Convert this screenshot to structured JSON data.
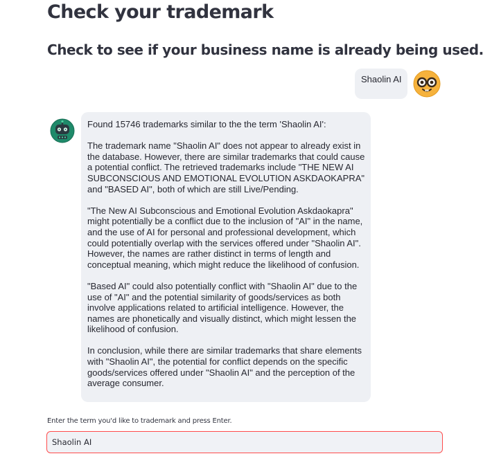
{
  "header": {
    "title": "Check your trademark",
    "subtitle": "Check to see if your business name is already being used."
  },
  "chat": {
    "user_message": {
      "text": "Shaolin AI",
      "avatar_icon": "nerd-face-emoji-icon"
    },
    "assistant_message": {
      "avatar_icon": "robot-avatar-icon",
      "paragraphs": [
        "Found 15746 trademarks similar to the the term 'Shaolin AI':",
        "The trademark name \"Shaolin AI\" does not appear to already exist in the database. However, there are similar trademarks that could cause a potential conflict. The retrieved trademarks include \"THE NEW AI SUBCONSCIOUS AND EMOTIONAL EVOLUTION ASKDAOKAPRA\" and \"BASED AI\", both of which are still Live/Pending.",
        "\"The New AI Subconscious and Emotional Evolution Askdaokapra\" might potentially be a conflict due to the inclusion of \"AI\" in the name, and the use of AI for personal and professional development, which could potentially overlap with the services offered under \"Shaolin AI\". However, the names are rather distinct in terms of length and conceptual meaning, which might reduce the likelihood of confusion.",
        "\"Based AI\" could also potentially conflict with \"Shaolin AI\" due to the use of \"AI\" and the potential similarity of goods/services as both involve applications related to artificial intelligence. However, the names are phonetically and visually distinct, which might lessen the likelihood of confusion.",
        "In conclusion, while there are similar trademarks that share elements with \"Shaolin AI\", the potential for conflict depends on the specific goods/services offered under \"Shaolin AI\" and the perception of the average consumer."
      ]
    }
  },
  "input": {
    "label": "Enter the term you'd like to trademark and press Enter.",
    "value": "Shaolin AI"
  },
  "colors": {
    "bubble_bg": "#eef0f4",
    "input_border_focus": "#ff4b4b",
    "text": "#262730",
    "heading": "#31333f",
    "bot_avatar": "#1f8a6a",
    "user_avatar": "#f6b23c"
  }
}
